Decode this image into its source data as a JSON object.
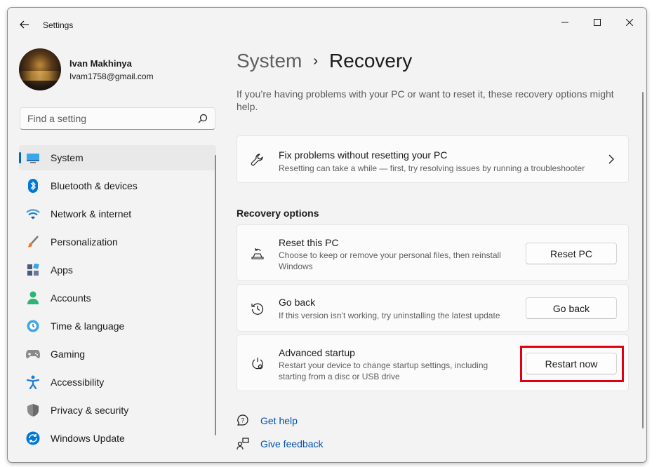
{
  "window": {
    "app_title": "Settings"
  },
  "profile": {
    "name": "Ivan Makhinya",
    "email": "Ivam1758@gmail.com"
  },
  "search": {
    "placeholder": "Find a setting"
  },
  "sidebar": {
    "items": [
      {
        "label": "System",
        "icon": "system-icon",
        "active": true
      },
      {
        "label": "Bluetooth & devices",
        "icon": "bluetooth-icon"
      },
      {
        "label": "Network & internet",
        "icon": "wifi-icon"
      },
      {
        "label": "Personalization",
        "icon": "brush-icon"
      },
      {
        "label": "Apps",
        "icon": "apps-icon"
      },
      {
        "label": "Accounts",
        "icon": "person-icon"
      },
      {
        "label": "Time & language",
        "icon": "clock-globe-icon"
      },
      {
        "label": "Gaming",
        "icon": "gamepad-icon"
      },
      {
        "label": "Accessibility",
        "icon": "accessibility-icon"
      },
      {
        "label": "Privacy & security",
        "icon": "shield-icon"
      },
      {
        "label": "Windows Update",
        "icon": "update-icon"
      }
    ]
  },
  "breadcrumb": {
    "parent": "System",
    "current": "Recovery",
    "separator": "›"
  },
  "intro": "If you’re having problems with your PC or want to reset it, these recovery options might help.",
  "fix_card": {
    "title": "Fix problems without resetting your PC",
    "description": "Resetting can take a while — first, try resolving issues by running a troubleshooter"
  },
  "recovery_options": {
    "section_title": "Recovery options",
    "reset": {
      "title": "Reset this PC",
      "description": "Choose to keep or remove your personal files, then reinstall Windows",
      "button": "Reset PC"
    },
    "go_back": {
      "title": "Go back",
      "description": "If this version isn’t working, try uninstalling the latest update",
      "button": "Go back"
    },
    "advanced": {
      "title": "Advanced startup",
      "description": "Restart your device to change startup settings, including starting from a disc or USB drive",
      "button": "Restart now"
    }
  },
  "links": {
    "help": "Get help",
    "feedback": "Give feedback"
  },
  "colors": {
    "accent": "#0067c0",
    "highlight": "#e00010",
    "link": "#0050b0"
  }
}
